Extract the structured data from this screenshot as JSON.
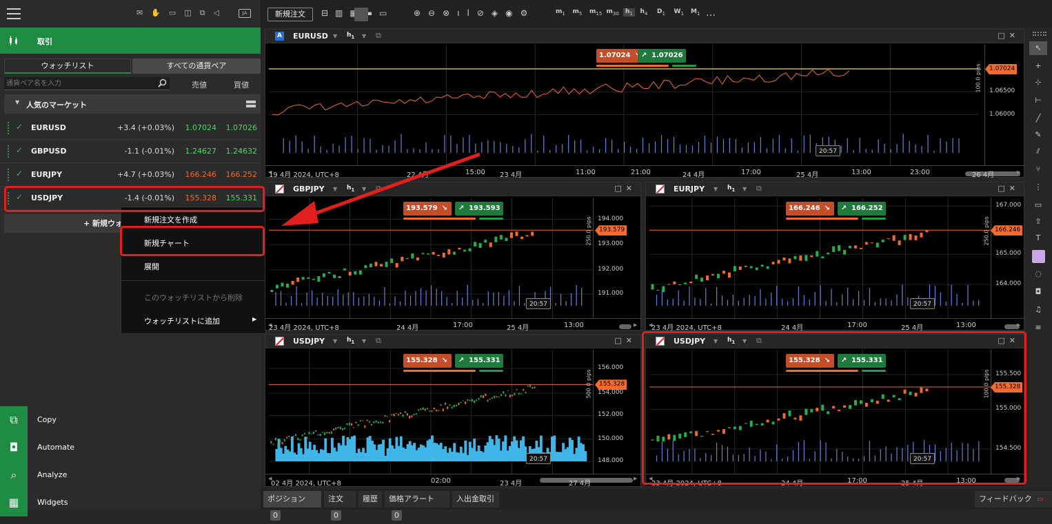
{
  "left": {
    "trade_label": "取引",
    "tabs": [
      "ウォッチリスト",
      "すべての通貨ペア"
    ],
    "search_placeholder": "通貨ペア名を入力",
    "col_sell": "売値",
    "col_buy": "買値",
    "group": "人気のマーケット",
    "rows": [
      {
        "symbol": "EURUSD",
        "change": "+3.4 (+0.03%)",
        "bid": "1.07024",
        "ask": "1.07026",
        "bid_color": "#4cd964",
        "ask_color": "#4cd964"
      },
      {
        "symbol": "GBPUSD",
        "change": "-1.1 (-0.01%)",
        "bid": "1.24627",
        "ask": "1.24632",
        "bid_color": "#4cd964",
        "ask_color": "#4cd964"
      },
      {
        "symbol": "EURJPY",
        "change": "+4.7 (+0.03%)",
        "bid": "166.246",
        "ask": "166.252",
        "bid_color": "#f26a2e",
        "ask_color": "#f26a2e"
      },
      {
        "symbol": "USDJPY",
        "change": "-1.4 (-0.01%)",
        "bid": "155.328",
        "ask": "155.331",
        "bid_color": "#f26a2e",
        "ask_color": "#4cd964"
      }
    ],
    "new_watchlist": "+ 新規ウォ",
    "context_menu": [
      "新規注文を作成",
      "新規チャート",
      "展開",
      "このウォッチリストから削除",
      "ウォッチリストに追加"
    ],
    "bottom_menu": [
      "Copy",
      "Automate",
      "Analyze",
      "Widgets"
    ]
  },
  "toolbar": {
    "new_order": "新規注文",
    "timeframes": [
      "m1",
      "m5",
      "m15",
      "m30",
      "h1",
      "h4",
      "D1",
      "W1",
      "M1"
    ],
    "more": "…"
  },
  "charts": {
    "eurusd": {
      "symbol": "EURUSD",
      "flag": "A",
      "tf": "h1",
      "sell": "1.07024",
      "buy": "1.07026",
      "price": "1.07024",
      "pips": "100.0 pips",
      "yticks": [
        "1.06500",
        "1.06000"
      ],
      "xlabels": [
        "19 4月 2024, UTC+8",
        "22 4月",
        "15:00",
        "23 4月",
        "11:00",
        "21:00",
        "24 4月",
        "17:00",
        "25 4月",
        "13:00",
        "23:00",
        "26 4月"
      ],
      "clock": "20:57"
    },
    "gbpjpy": {
      "symbol": "GBPJPY",
      "tf": "h1",
      "sell": "193.579",
      "buy": "193.593",
      "price": "193.579",
      "pips": "250.0 pips",
      "yticks": [
        "194.000",
        "193.000",
        "192.000",
        "191.000"
      ],
      "xlabels": [
        "23 4月 2024, UTC+8",
        "24 4月",
        "17:00",
        "25 4月",
        "13:00"
      ],
      "clock": "20:57"
    },
    "eurjpy": {
      "symbol": "EURJPY",
      "tf": "h1",
      "sell": "166.246",
      "buy": "166.252",
      "price": "166.246",
      "pips": "250.0 pips",
      "yticks": [
        "167.000",
        "165.000",
        "164.000"
      ],
      "xlabels": [
        "23 4月 2024, UTC+8",
        "24 4月",
        "17:00",
        "25 4月",
        "13:00"
      ],
      "clock": "20:57"
    },
    "usdjpy_a": {
      "symbol": "USDJPY",
      "tf": "h1",
      "sell": "155.328",
      "buy": "155.331",
      "price": "155.328",
      "pips": "500.0 pips",
      "yticks": [
        "156.000",
        "154.000",
        "152.000",
        "150.000",
        "148.000"
      ],
      "xlabels": [
        "02 4月 2024, UTC+8",
        "02:00",
        "23 4月",
        "27 4月"
      ],
      "clock": "20:57"
    },
    "usdjpy_b": {
      "symbol": "USDJPY",
      "tf": "h1",
      "sell": "155.328",
      "buy": "155.331",
      "price": "155.328",
      "pips": "100.0 pips",
      "yticks": [
        "155.500",
        "155.000",
        "154.500"
      ],
      "xlabels": [
        "23 4月 2024, UTC+8",
        "24 4月",
        "17:00",
        "25 4月",
        "13:00"
      ],
      "clock": "20:57"
    }
  },
  "bottom_tabs": [
    {
      "label": "ポジション",
      "count": "0"
    },
    {
      "label": "注文",
      "count": "0"
    },
    {
      "label": "履歴",
      "count": ""
    },
    {
      "label": "価格アラート",
      "count": "0"
    },
    {
      "label": "入出金取引",
      "count": ""
    }
  ],
  "feedback": "フィードバック",
  "colors": {
    "green": "#1e8c43",
    "sell": "#c44d2a",
    "buy": "#1f7a3e",
    "highlight": "#e21f1f"
  }
}
